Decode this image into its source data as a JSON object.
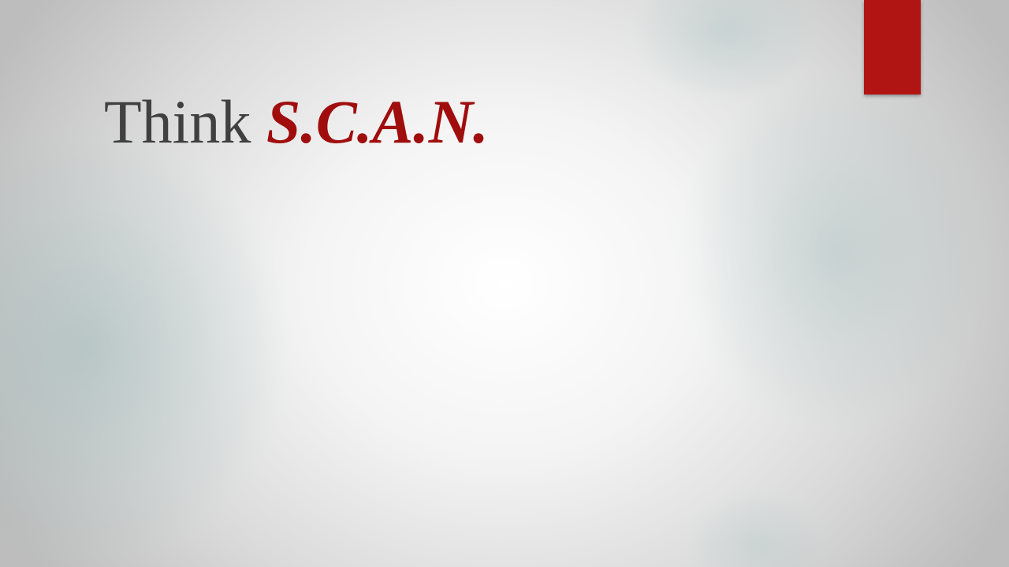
{
  "slide": {
    "title_plain": "Think ",
    "title_emphasis": "S.C.A.N."
  },
  "colors": {
    "accent": "#b01513",
    "title_text": "#404040",
    "title_emphasis": "#a00d0d"
  }
}
